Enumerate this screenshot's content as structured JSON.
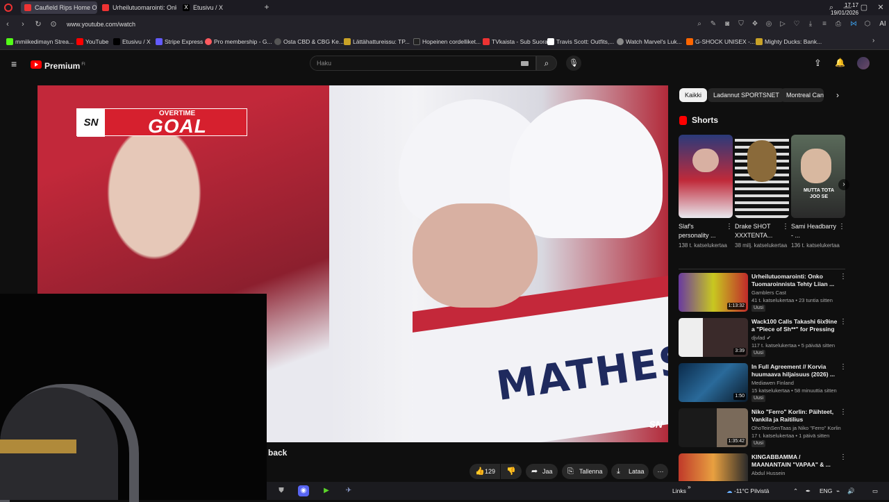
{
  "browser": {
    "tabs": [
      {
        "title": "Caufield Rips Home OT W",
        "color": "#e33",
        "active": true
      },
      {
        "title": "Urheilutuomarointi: Onko",
        "color": "#e33",
        "active": false
      },
      {
        "title": "Etusivu / X",
        "color": "#000",
        "active": false
      }
    ],
    "new_tab_label": "+",
    "url": "www.youtube.com/watch",
    "bookmarks": [
      {
        "label": "mmiikedimayn Strea...",
        "color": "#53fc18"
      },
      {
        "label": "YouTube",
        "color": "#f00"
      },
      {
        "label": "Etusivu / X",
        "color": "#000"
      },
      {
        "label": "Stripe Express",
        "color": "#635bff"
      },
      {
        "label": "Pro membership - G...",
        "color": "#ff5a5f"
      },
      {
        "label": "Osta CBD & CBG Ke...",
        "color": "#555"
      },
      {
        "label": "Lättähattureissu: TP...",
        "color": "#c9a227"
      },
      {
        "label": "Hopeinen cordelliket...",
        "color": "#222"
      },
      {
        "label": "TVkaista - Sub Suora",
        "color": "#e33"
      },
      {
        "label": "Travis Scott: Outfits,...",
        "color": "#fff"
      },
      {
        "label": "Watch Marvel's Luk...",
        "color": "#888"
      },
      {
        "label": "G-SHOCK UNISEX -...",
        "color": "#f60"
      },
      {
        "label": "Mighty Ducks: Bank...",
        "color": "#c9a227"
      }
    ]
  },
  "youtube": {
    "logo_text": "Premium",
    "logo_sup": "FI",
    "search_placeholder": "Haku",
    "video": {
      "overlay_small": "OVERTIME",
      "overlay_big": "GOAL",
      "network": "SN",
      "jersey_name": "MATHES"
    },
    "title_fragment": "back",
    "actions": {
      "likes": "129",
      "share": "Jaa",
      "save": "Tallenna",
      "download": "Lataa"
    },
    "chips": [
      "Kaikki",
      "Ladannut SPORTSNET",
      "Montreal Canadiens"
    ],
    "shorts_title": "Shorts",
    "shorts": [
      {
        "title": "Slaf's personality ...",
        "views": "138 t. katselukertaa",
        "thumb_text": ""
      },
      {
        "title": "Drake SHOT XXXTENTA...",
        "views": "38 milj. katselukertaa",
        "thumb_text": ""
      },
      {
        "title": "Sami Headbarry - ...",
        "views": "136 t. katselukertaa",
        "thumb_text": "MUTTA TOTA JOO SE"
      }
    ],
    "recommendations": [
      {
        "title": "Urheilutuomarointi: Onko Tuomaroinnista Tehty Liian ...",
        "channel": "Gamblers Cast",
        "meta": "41 t. katselukertaa • 23 tuntia sitten",
        "badge": "Uusi",
        "duration": "1:13:32"
      },
      {
        "title": "Wack100 Calls Takashi 6ix9ine a \"Piece of Sh**\" for Pressing ...",
        "channel": "djvlad",
        "meta": "117 t. katselukertaa • 5 päivää sitten",
        "badge": "Uusi",
        "duration": "3:39"
      },
      {
        "title": "In Full Agreement // Korvia huumaava hiljaisuus (2026) ...",
        "channel": "Mediawen Finland",
        "meta": "15 katselukertaa • 58 minuuttia sitten",
        "badge": "Uusi",
        "duration": "1:50"
      },
      {
        "title": "Niko \"Ferro\" Korlin: Päihteet, Vankila ja Raitilius",
        "channel": "OhoTeinSenTaas ja Niko \"Ferro\" Korlin",
        "meta": "17 t. katselukertaa • 1 päivä sitten",
        "badge": "Uusi",
        "duration": "1:35:42"
      },
      {
        "title": "KINGABBAMMA / MAANANTAIN \"VAPAA\" & ...",
        "channel": "Abdul Hussein",
        "meta": "",
        "badge": "",
        "duration": ""
      }
    ]
  },
  "taskbar": {
    "links_label": "Links",
    "weather": "-11°C  Pilvistä",
    "language": "ENG",
    "time": "17.17",
    "date": "19/01/2026"
  }
}
